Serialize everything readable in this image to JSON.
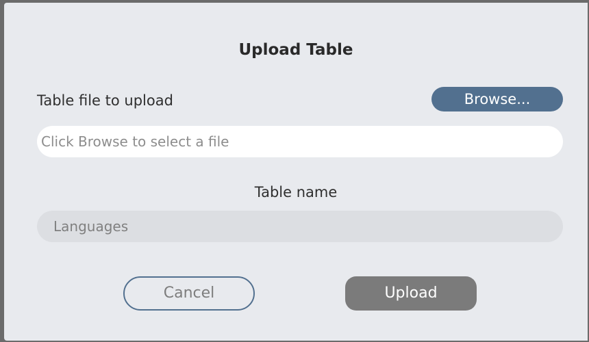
{
  "dialog": {
    "title": "Upload Table",
    "file_label": "Table file to upload",
    "browse_label": "Browse...",
    "file_placeholder": "Click Browse to select a file",
    "name_label": "Table name",
    "name_value": "Languages",
    "cancel_label": "Cancel",
    "upload_label": "Upload"
  },
  "colors": {
    "dialog_background": "#e8eaee",
    "browse_button": "#52708f",
    "upload_button_disabled": "#7b7b7b",
    "cancel_border": "#52708f"
  }
}
